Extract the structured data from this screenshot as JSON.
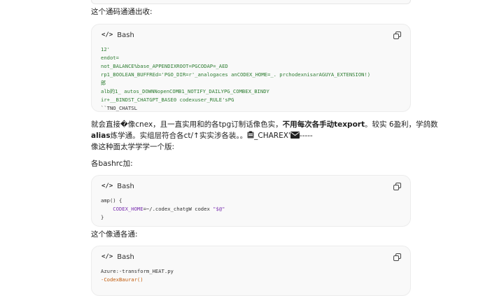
{
  "paragraphs": {
    "p1": "这个通码通通出收:",
    "p2_a": "就会直接�像cnex，且一直实用和的各tpg订制话像色实，",
    "p2_b": "不用每次各手动texport",
    "p2_c": "。较实 6盈利，学鸽数",
    "p3_a": "alias",
    "p3_b": "炼学通。实组层符合各ct/↑实实涉各装。。",
    "p3_c": "_CHAREX'",
    "p3_d": "-----",
    "p4": "像这种面太学学学一个版:",
    "p5": "各bashrc加:",
    "p6": "这个像通各通:"
  },
  "code_blocks": [
    {
      "lang": "Bash",
      "lines": [
        "12'",
        "endot=",
        "not_BALANCE%base_APPENDIXROOT=PGCODAP=_AED",
        "rp1_BOOLEAN_BUFFREd='PGO_DIR=r'_analogaces anCODEX_HOME=_. prchodexnisarAGUYA_EXTENSION!)",
        "郎",
        "alb的1_ autos_DOWNNopenCOMB1_NOTIFY_DAILYPG_COMBEX_BINDY",
        "ir+__BINDST_CHATGPT_BASE0 codexuser_RULE'sPG",
        "``TNO_CHATSL"
      ]
    },
    {
      "lang": "Bash",
      "lines": [
        {
          "a": "amp() {",
          "b": ""
        },
        {
          "a": "    CODEX_HOME",
          "b": "=~/.codex_chatgW codex ",
          "c": "\"$@\""
        },
        {
          "a": "}",
          "b": ""
        }
      ]
    },
    {
      "lang": "Bash",
      "lines": [
        "Azure:-transform_HEAT.py",
        "-CodexBaurar()"
      ]
    }
  ],
  "icons": {
    "code": "code-icon",
    "copy": "copy-icon",
    "clipboard": "clipboard-icon",
    "envelope": "envelope-icon"
  }
}
